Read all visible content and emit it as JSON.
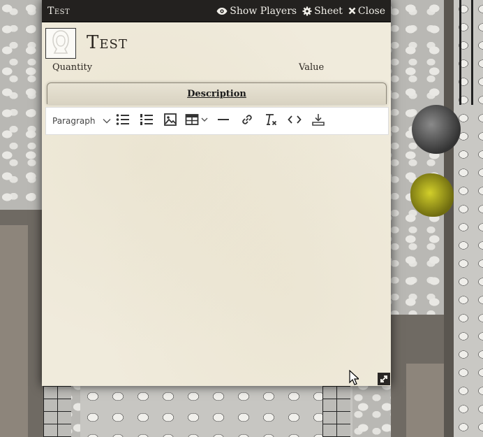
{
  "window": {
    "title": "Test",
    "controls": {
      "show_players": "Show Players",
      "sheet": "Sheet",
      "close": "Close"
    }
  },
  "item": {
    "name": "Test",
    "quantity_label": "Quantity",
    "value_label": "Value"
  },
  "tabs": [
    {
      "label": "Description",
      "active": true
    }
  ],
  "toolbar": {
    "block_format": "Paragraph",
    "buttons": [
      "bulleted-list",
      "numbered-list",
      "image",
      "table",
      "horizontal-line",
      "link",
      "clear-formatting",
      "source-code",
      "save"
    ]
  },
  "colors": {
    "titlebar": "#23211f",
    "parchment": "#f0ebdc",
    "text": "#2b2620"
  }
}
